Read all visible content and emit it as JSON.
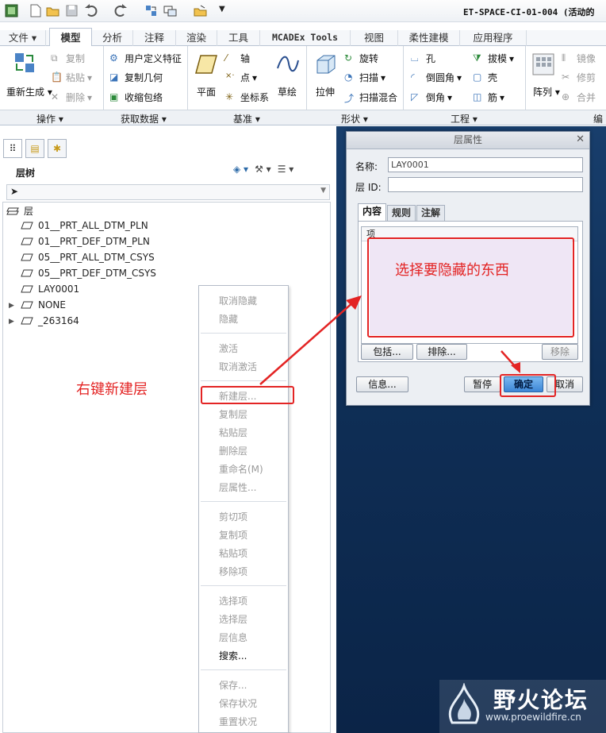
{
  "window": {
    "title": "ET-SPACE-CI-01-004 (活动的"
  },
  "tabs": [
    {
      "label": "文件"
    },
    {
      "label": "模型"
    },
    {
      "label": "分析"
    },
    {
      "label": "注释"
    },
    {
      "label": "渲染"
    },
    {
      "label": "工具"
    },
    {
      "label": "MCADEx Tools"
    },
    {
      "label": "视图"
    },
    {
      "label": "柔性建模"
    },
    {
      "label": "应用程序"
    }
  ],
  "ribbon": {
    "regen": "重新生成",
    "copy": "复制",
    "paste": "粘贴",
    "delete": "删除",
    "udf": "用户定义特征",
    "copy_geom": "复制几何",
    "shrinkwrap": "收缩包络",
    "plane": "平面",
    "axis": "轴",
    "point": "点",
    "csys": "坐标系",
    "sketch": "草绘",
    "extrude": "拉伸",
    "revolve": "旋转",
    "sweep": "扫描",
    "swept_blend": "扫描混合",
    "hole": "孔",
    "round": "倒圆角",
    "chamfer": "倒角",
    "draft": "拔模",
    "shell": "壳",
    "rib": "筋",
    "pattern": "阵列",
    "mirror": "镜像",
    "trim": "修剪",
    "merge": "合并",
    "groups": {
      "operations": "操作",
      "get_data": "获取数据",
      "datum": "基准",
      "shapes": "形状",
      "engineering": "工程",
      "editing": "编"
    }
  },
  "panel": {
    "tree_title": "层树",
    "layers": [
      {
        "label": "层"
      },
      {
        "label": "01__PRT_ALL_DTM_PLN"
      },
      {
        "label": "01__PRT_DEF_DTM_PLN"
      },
      {
        "label": "05__PRT_ALL_DTM_CSYS"
      },
      {
        "label": "05__PRT_DEF_DTM_CSYS"
      },
      {
        "label": "LAY0001"
      },
      {
        "label": "NONE"
      },
      {
        "label": "_263164"
      }
    ]
  },
  "context_menu": {
    "items": [
      {
        "label": "取消隐藏"
      },
      {
        "label": "隐藏"
      },
      {
        "label": "激活"
      },
      {
        "label": "取消激活"
      },
      {
        "label": "新建层..."
      },
      {
        "label": "复制层"
      },
      {
        "label": "粘贴层"
      },
      {
        "label": "删除层"
      },
      {
        "label": "重命名(M)"
      },
      {
        "label": "层属性..."
      },
      {
        "label": "剪切项"
      },
      {
        "label": "复制项"
      },
      {
        "label": "粘贴项"
      },
      {
        "label": "移除项"
      },
      {
        "label": "选择项"
      },
      {
        "label": "选择层"
      },
      {
        "label": "层信息"
      },
      {
        "label": "搜索..."
      },
      {
        "label": "保存..."
      },
      {
        "label": "保存状况"
      },
      {
        "label": "重置状况"
      }
    ]
  },
  "dialog": {
    "title": "层属性",
    "name_label": "名称:",
    "name_value": "LAY0001",
    "id_label": "层 ID:",
    "id_value": "",
    "tabs": [
      "内容",
      "规则",
      "注解"
    ],
    "list_header": "项",
    "include": "包括...",
    "exclude": "排除...",
    "remove": "移除",
    "info": "信息...",
    "pause": "暂停",
    "ok": "确定",
    "cancel": "取消"
  },
  "annotations": {
    "right_click_text": "右键新建层",
    "select_text": "选择要隐藏的东西",
    "color": "#e32424"
  },
  "watermark": {
    "name": "野火论坛",
    "url": "www.proewildfire.cn"
  }
}
